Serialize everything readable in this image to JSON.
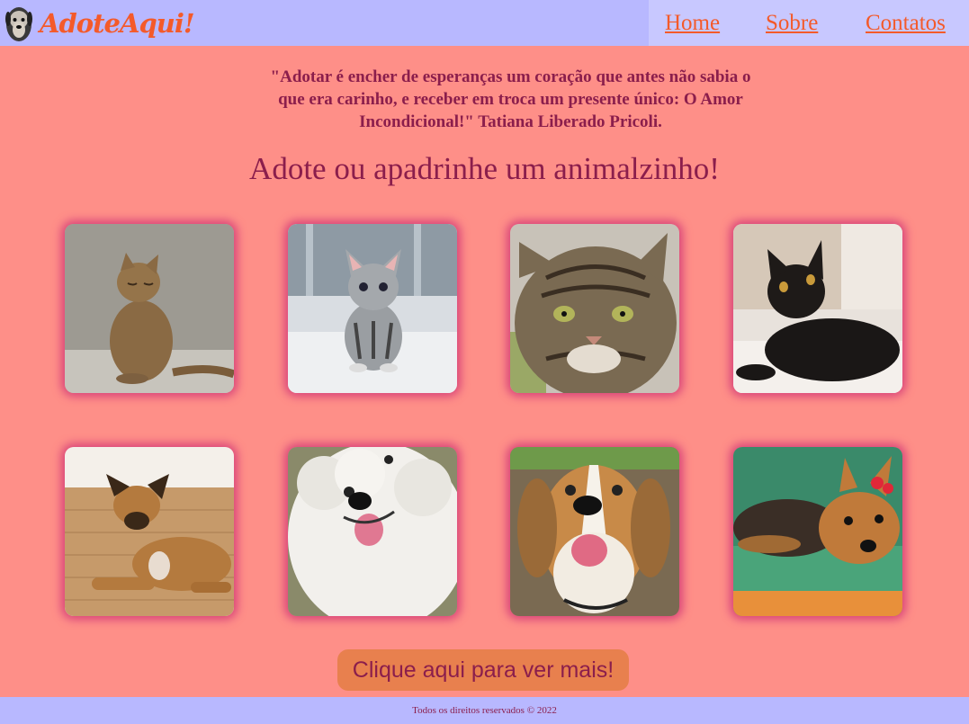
{
  "header": {
    "logo_text": "AdoteAqui!",
    "nav": [
      {
        "label": "Home"
      },
      {
        "label": "Sobre"
      },
      {
        "label": "Contatos"
      }
    ]
  },
  "quote": "\"Adotar é encher de esperanças um coração que antes não sabia o que era carinho, e receber em troca um presente único: O Amor Incondicional!\" Tatiana Liberado Pricoli.",
  "heading": "Adote ou apadrinhe um animalzinho!",
  "cards": [
    {
      "animal": "tabby-cat-sitting-photo"
    },
    {
      "animal": "gray-kitten-photo"
    },
    {
      "animal": "tabby-cat-face-photo"
    },
    {
      "animal": "black-cat-lying-photo"
    },
    {
      "animal": "brown-dog-lying-photo"
    },
    {
      "animal": "white-poodle-photo"
    },
    {
      "animal": "beagle-photo"
    },
    {
      "animal": "yorkshire-terrier-photo"
    }
  ],
  "more_button": "Clique aqui para ver mais!",
  "footer": "Todos os direitos reservados © 2022",
  "colors": {
    "background": "#fe8f88",
    "header": "#b8b8ff",
    "nav_bg": "#c8c8ff",
    "accent": "#f45a2a",
    "text": "#8b1e4c",
    "button": "#e8804e"
  }
}
